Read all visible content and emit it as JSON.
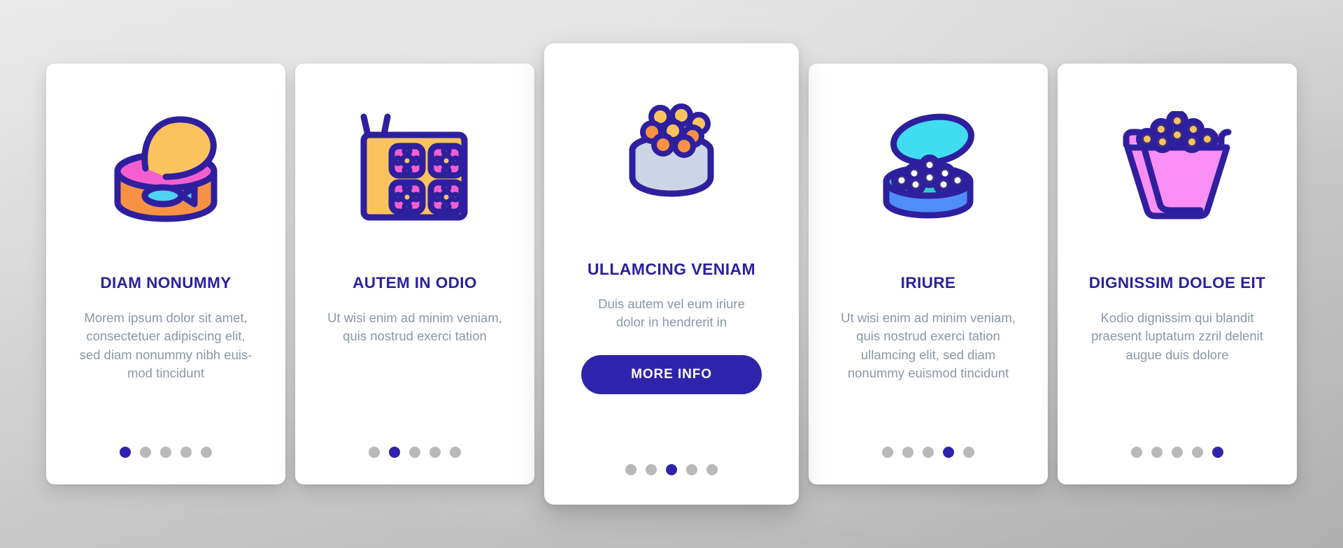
{
  "theme": {
    "background": "#d2d2d2",
    "card_background": "#ffffff",
    "title_color": "#2e1f9e",
    "body_color": "#8b97a5",
    "accent": "#3023ab",
    "dot_inactive": "#b9b9b9",
    "dot_active": "#3023ab",
    "outline": "#2e1f9e"
  },
  "cards": [
    {
      "id": "card-diam-nonummy",
      "icon": "canned-fish-tin-icon",
      "title": "DIAM NONUMMY",
      "body": "Morem ipsum dolor sit amet, consectetuer adipiscing elit, sed diam nonummy nibh euis-mod tincidunt",
      "featured": false,
      "button": null,
      "dots": {
        "count": 5,
        "active_index": 0
      }
    },
    {
      "id": "card-autem-in-odio",
      "icon": "sushi-bento-box-icon",
      "title": "AUTEM IN ODIO",
      "body": "Ut wisi enim ad minim veniam, quis nostrud exerci tation",
      "featured": false,
      "button": null,
      "dots": {
        "count": 5,
        "active_index": 1
      }
    },
    {
      "id": "card-ullamcing-veniam",
      "icon": "caviar-bowl-icon",
      "title": "ULLAMCING VENIAM",
      "body": "Duis autem vel eum iriure dolor in hendrerit in",
      "featured": true,
      "button": "MORE INFO",
      "dots": {
        "count": 5,
        "active_index": 2
      }
    },
    {
      "id": "card-iriure",
      "icon": "caviar-tin-open-icon",
      "title": "IRIURE",
      "body": "Ut wisi enim ad minim veniam, quis nostrud exerci tation ullamcing elit, sed diam nonummy euismod tincidunt",
      "featured": false,
      "button": null,
      "dots": {
        "count": 5,
        "active_index": 3
      }
    },
    {
      "id": "card-dignissim-doloe-eit",
      "icon": "caviar-bucket-icon",
      "title": "DIGNISSIM DOLOE EIT",
      "body": "Kodio dignissim qui blandit praesent luptatum zzril delenit augue duis dolore",
      "featured": false,
      "button": null,
      "dots": {
        "count": 5,
        "active_index": 4
      }
    }
  ]
}
